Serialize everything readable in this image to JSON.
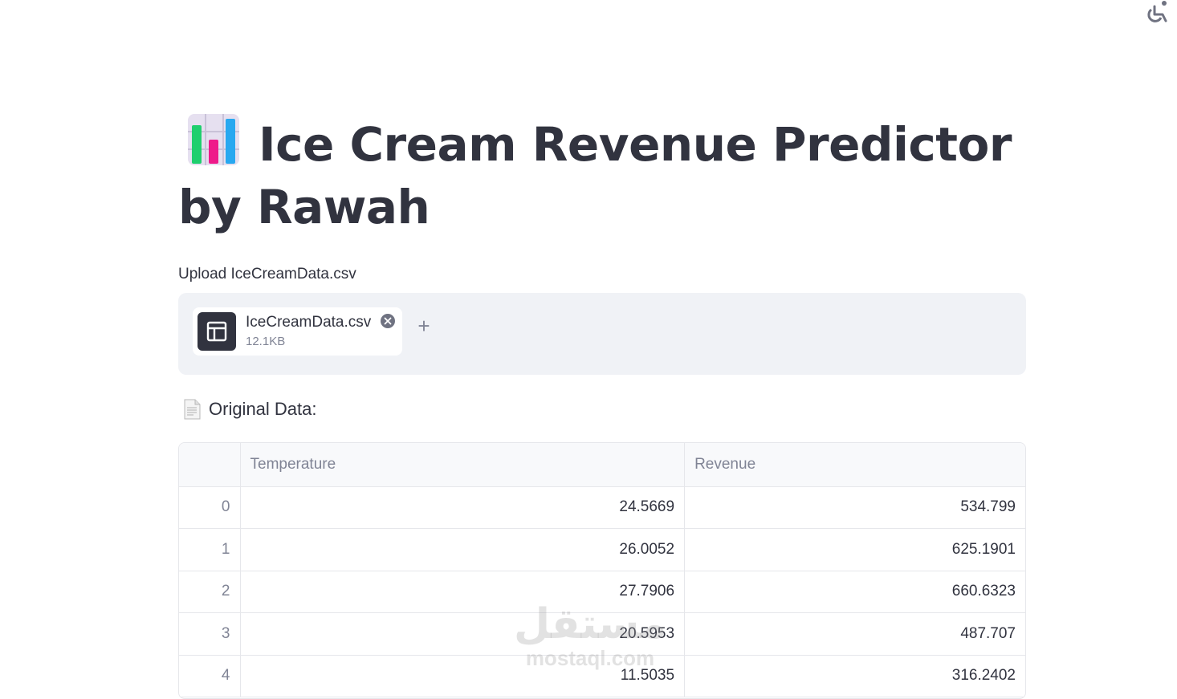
{
  "header": {
    "title": "Ice Cream Revenue Predictor by Rawah",
    "title_icon": "bar-chart-icon"
  },
  "uploader": {
    "label": "Upload IceCreamData.csv",
    "file": {
      "name": "IceCreamData.csv",
      "size": "12.1KB",
      "icon": "table-icon"
    },
    "add_icon": "plus-icon",
    "add_label": "+"
  },
  "section": {
    "icon": "document-icon",
    "title": "Original Data:"
  },
  "table": {
    "columns": [
      "",
      "Temperature",
      "Revenue"
    ],
    "rows": [
      {
        "index": "0",
        "temperature": "24.5669",
        "revenue": "534.799"
      },
      {
        "index": "1",
        "temperature": "26.0052",
        "revenue": "625.1901"
      },
      {
        "index": "2",
        "temperature": "27.7906",
        "revenue": "660.6323"
      },
      {
        "index": "3",
        "temperature": "20.5953",
        "revenue": "487.707"
      },
      {
        "index": "4",
        "temperature": "11.5035",
        "revenue": "316.2402"
      }
    ]
  },
  "watermark": {
    "arabic": "مستقل",
    "latin": "mostaql.com"
  },
  "colors": {
    "text": "#31333f",
    "muted": "#808495",
    "panel": "#f0f2f6"
  }
}
